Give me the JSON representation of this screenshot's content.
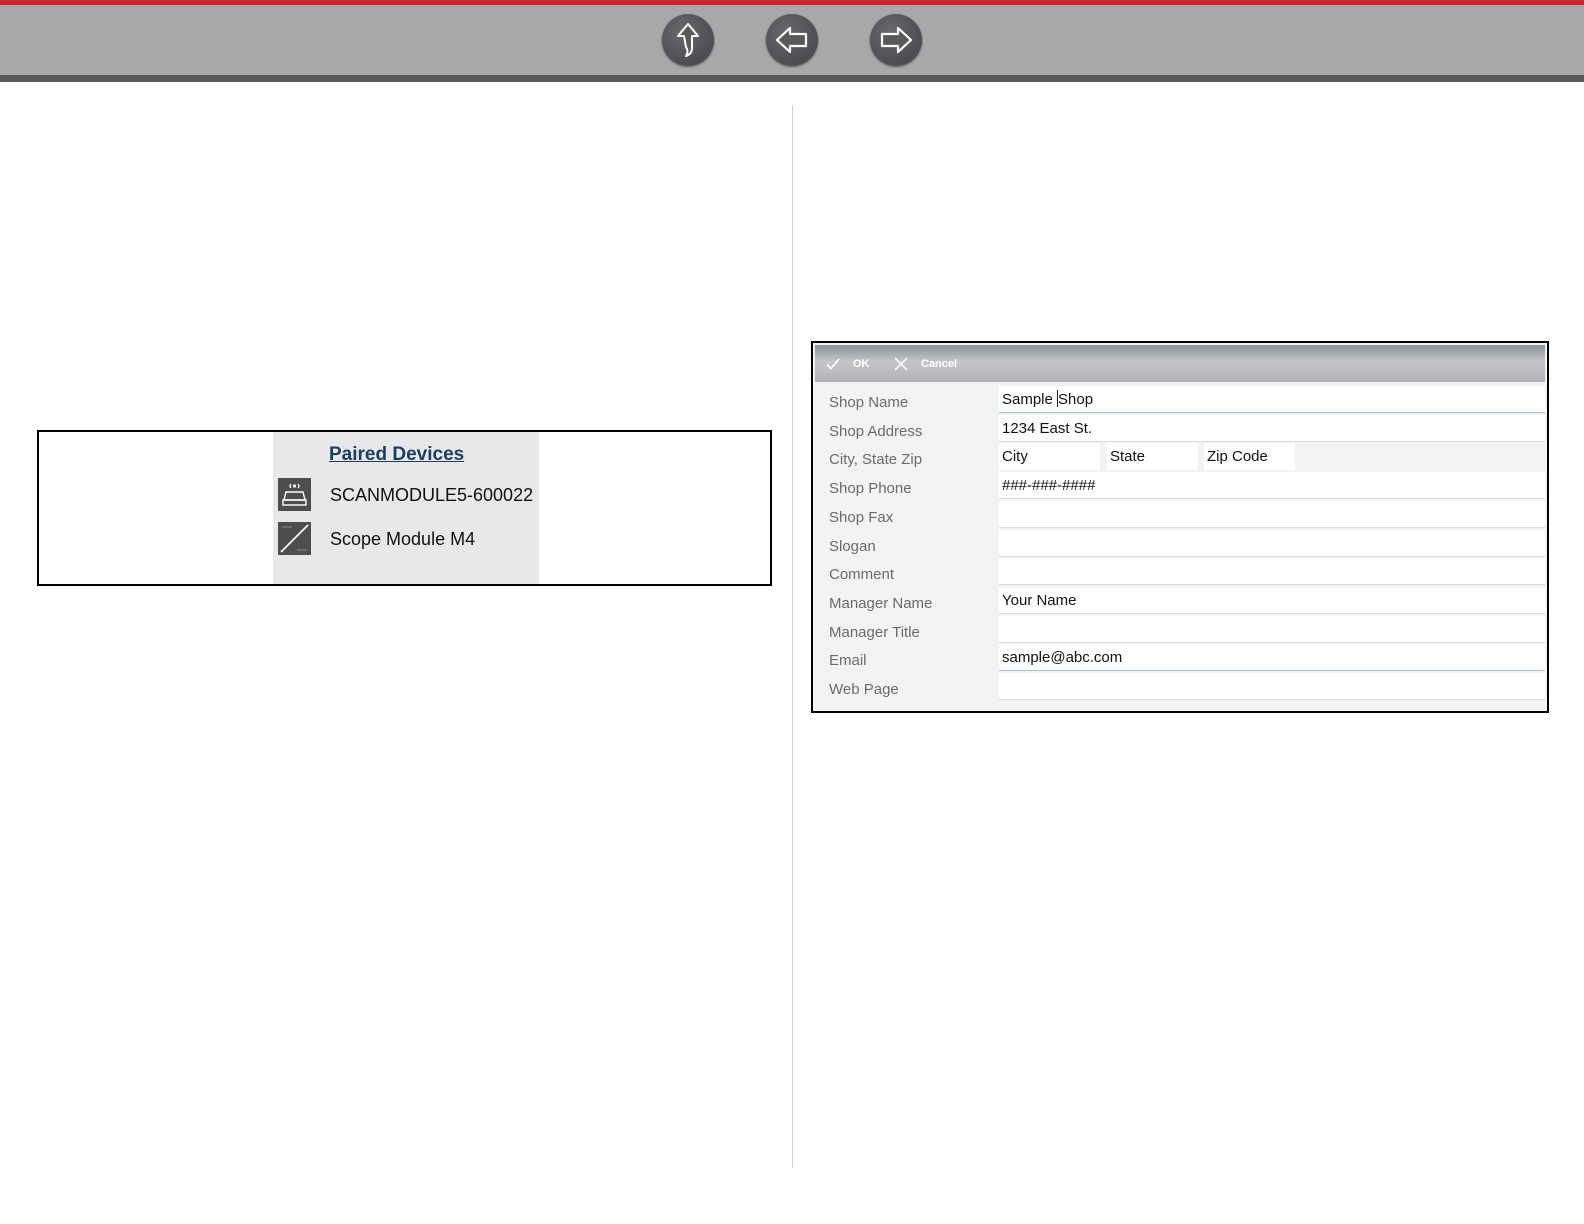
{
  "nav": {
    "up_icon": "up-arrow-icon",
    "back_icon": "left-arrow-icon",
    "forward_icon": "right-arrow-icon",
    "accent_red": "#d2232a",
    "bar_gray": "#a8a8a8"
  },
  "paired_devices": {
    "title": "Paired Devices",
    "devices": [
      {
        "label": "SCANMODULE5-600022",
        "icon": "scan-module-icon"
      },
      {
        "label": "Scope Module M4",
        "icon": "scope-module-icon"
      }
    ]
  },
  "shop_form": {
    "toolbar": {
      "ok_label": "OK",
      "cancel_label": "Cancel"
    },
    "fields": {
      "shop_name": {
        "label": "Shop Name",
        "value_before_caret": "Sample ",
        "value_after_caret": "Shop"
      },
      "shop_address": {
        "label": "Shop Address",
        "value": "1234 East St."
      },
      "city_state_zip": {
        "label": "City, State Zip",
        "city": "City",
        "state": "State",
        "zip": "Zip Code"
      },
      "shop_phone": {
        "label": "Shop Phone",
        "value": "###-###-####"
      },
      "shop_fax": {
        "label": "Shop Fax",
        "value": ""
      },
      "slogan": {
        "label": "Slogan",
        "value": ""
      },
      "comment": {
        "label": "Comment",
        "value": ""
      },
      "manager_name": {
        "label": "Manager Name",
        "value": "Your Name"
      },
      "manager_title": {
        "label": "Manager Title",
        "value": ""
      },
      "email": {
        "label": "Email",
        "value": "sample@abc.com"
      },
      "web_page": {
        "label": "Web Page",
        "value": ""
      }
    }
  }
}
